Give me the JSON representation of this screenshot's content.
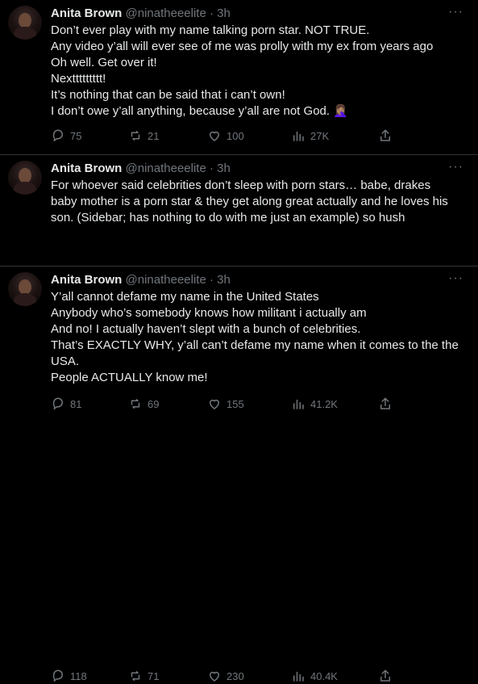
{
  "tweets": [
    {
      "name": "Anita Brown",
      "handle": "@ninatheeelite",
      "dot": "·",
      "time": "3h",
      "text": "Don’t ever play with my name talking porn star. NOT TRUE.\nAny video y’all will ever see of me was prolly with my ex from years ago\nOh well. Get over it!\nNexttttttttt!\nIt’s nothing that can be said that i can’t own!\nI don’t owe y’all anything, because y’all are not God. 🤦🏽‍♀️",
      "replies": "75",
      "retweets": "21",
      "likes": "100",
      "views": "27K"
    },
    {
      "name": "Anita Brown",
      "handle": "@ninatheeelite",
      "dot": "·",
      "time": "3h",
      "text": "For whoever said celebrities don’t sleep with porn stars… babe, drakes\nbaby mother is a porn star & they get along great actually and he loves his\nson. (Sidebar; has nothing to do with me just an example) so hush",
      "replies": "81",
      "retweets": "69",
      "likes": "155",
      "views": "41.2K"
    },
    {
      "name": "Anita Brown",
      "handle": "@ninatheeelite",
      "dot": "·",
      "time": "3h",
      "text": "Y’all cannot defame my name in the United States\nAnybody who’s somebody knows how militant i actually am\nAnd no! I actually haven’t slept with a bunch of celebrities.\nThat’s EXACTLY WHY, y’all can’t defame my name when it comes to the the\nUSA.\nPeople ACTUALLY know me!",
      "replies": "118",
      "retweets": "71",
      "likes": "230",
      "views": "40.4K"
    }
  ],
  "icons": {
    "reply": "reply-icon",
    "retweet": "retweet-icon",
    "like": "heart-icon",
    "views": "views-icon",
    "share": "share-icon",
    "more": "more-icon"
  },
  "more_label": "···"
}
